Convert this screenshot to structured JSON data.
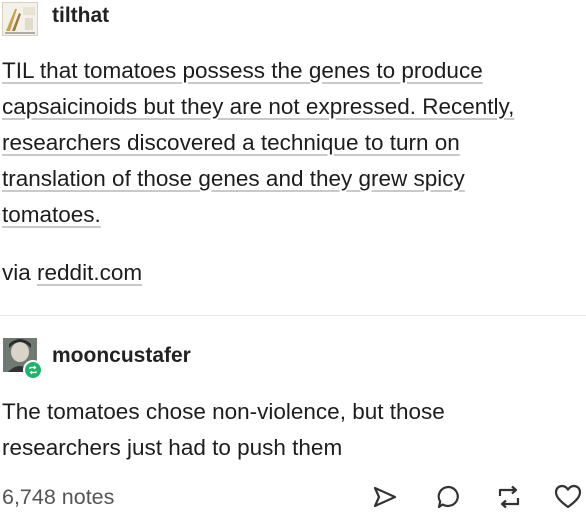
{
  "post": {
    "author": "tilthat",
    "body_lines": [
      "TIL that tomatoes possess the genes to produce",
      "capsaicinoids but they are not expressed. Recently,",
      "researchers discovered a technique to turn on",
      "translation of those genes and they grew spicy",
      "tomatoes."
    ],
    "via_prefix": "via",
    "via_link": "reddit.com"
  },
  "reblog": {
    "author": "mooncustafer",
    "lines": [
      "The tomatoes chose non-violence, but those",
      "researchers just had to push them"
    ]
  },
  "footer": {
    "notes": "6,748 notes",
    "icons": [
      "share-icon",
      "comment-icon",
      "reblog-icon",
      "heart-icon"
    ]
  },
  "colors": {
    "reblog_badge": "#1fb36b",
    "text": "#1d1d1d",
    "muted": "#555555"
  }
}
